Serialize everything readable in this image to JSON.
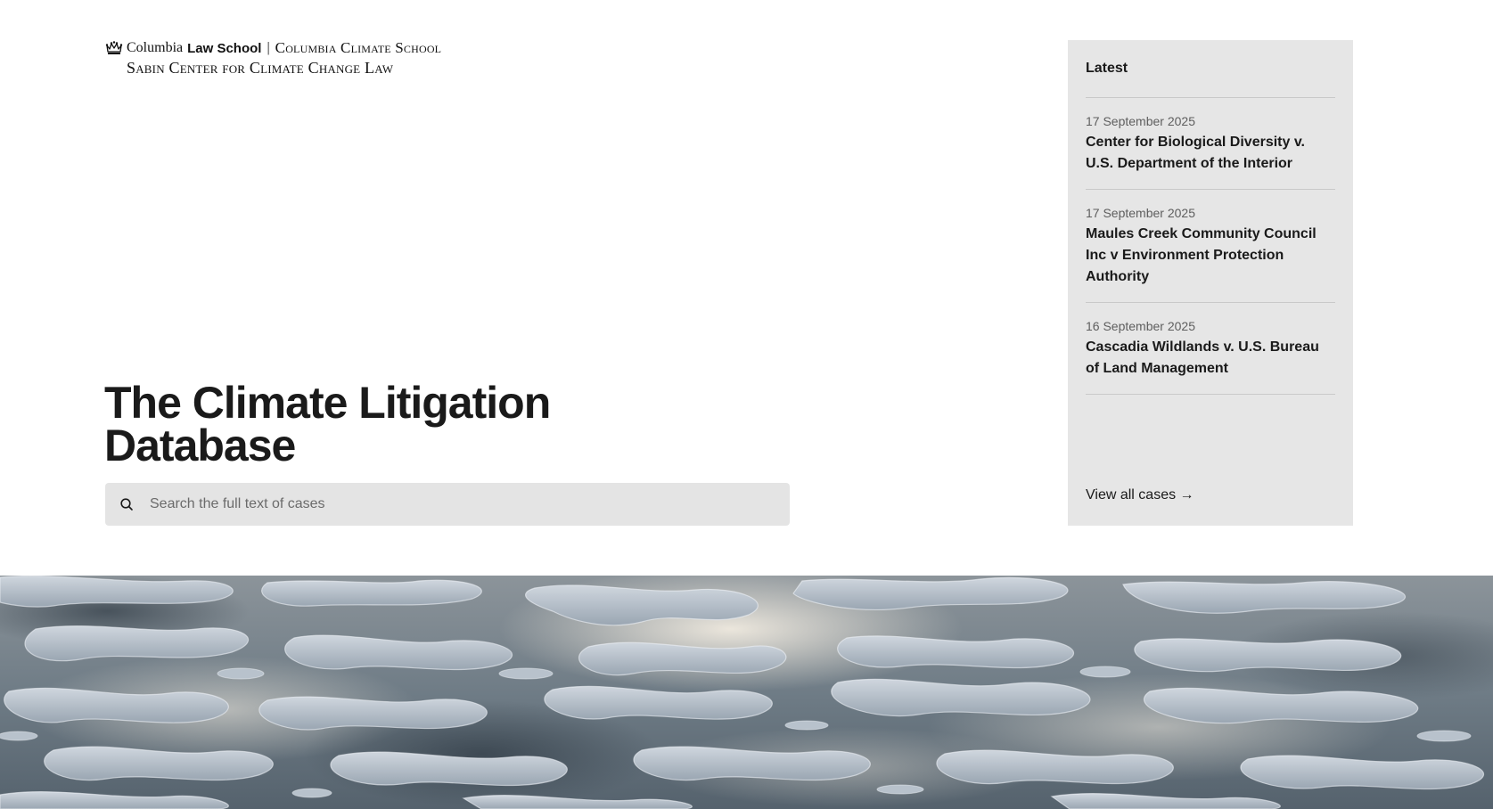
{
  "logo": {
    "institution": "Columbia",
    "school": "Law School",
    "separator": "|",
    "climate_school": "Columbia Climate School",
    "center": "Sabin Center for Climate Change Law"
  },
  "main": {
    "title": "The Climate Litigation Database",
    "search": {
      "placeholder": "Search the full text of cases",
      "value": ""
    }
  },
  "latest": {
    "heading": "Latest",
    "items": [
      {
        "date": "17 September 2025",
        "title": "Center for Biological Diversity v. U.S. Department of the Interior"
      },
      {
        "date": "17 September 2025",
        "title": "Maules Creek Community Council Inc v Environment Protection Authority"
      },
      {
        "date": "16 September 2025",
        "title": "Cascadia Wildlands v. U.S. Bureau of Land Management"
      }
    ],
    "view_all": "View all cases →"
  },
  "hero": {
    "image": "sea-ice-melt-ponds-photo"
  },
  "colors": {
    "panel_bg": "#e6e6e6",
    "search_bg": "#e4e4e4",
    "text": "#1a1a1a",
    "muted": "#5e5e5e"
  },
  "icons": {
    "logo": "columbia-crown-icon",
    "search": "search-icon"
  }
}
